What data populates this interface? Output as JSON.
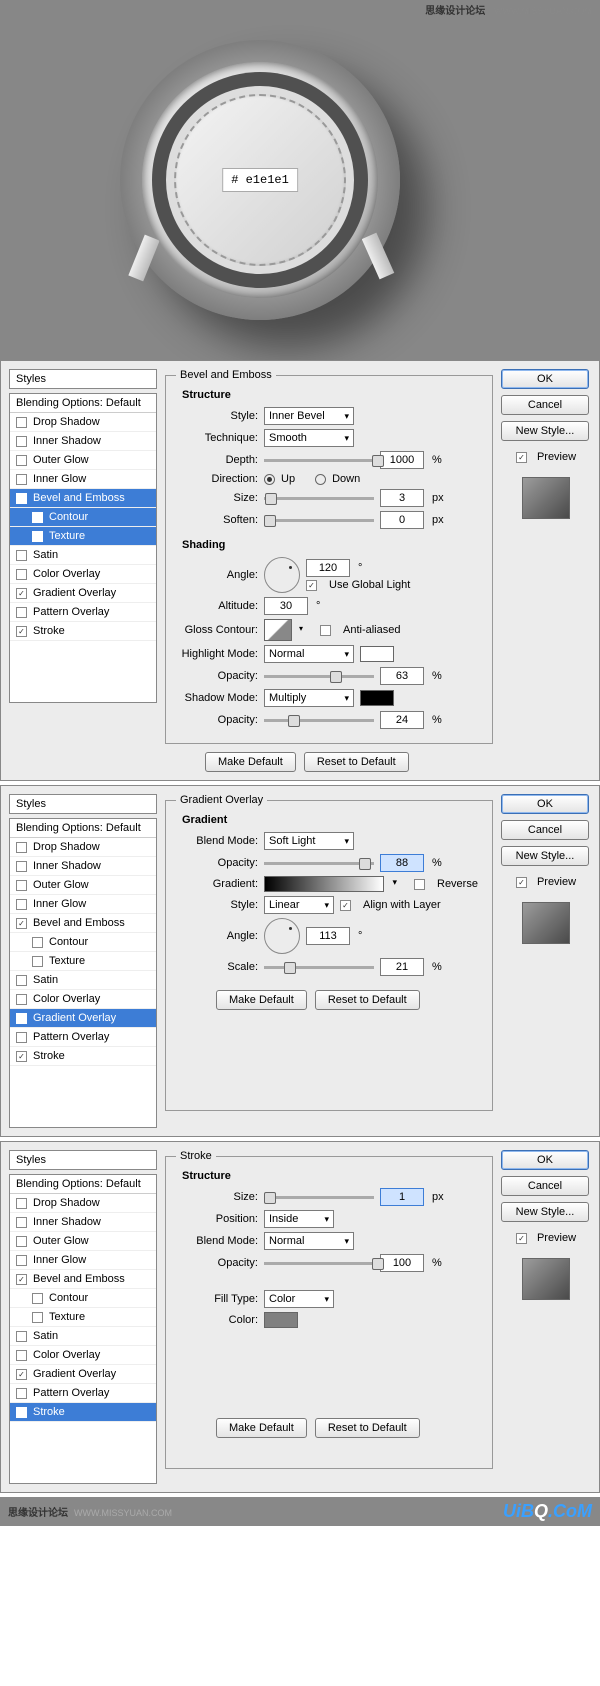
{
  "watermark": {
    "title": "思缘设计论坛",
    "url": "WWW.MISSYUAN.COM"
  },
  "knob": {
    "color_label": "# e1e1e1"
  },
  "common": {
    "styles_head": "Styles",
    "blending_header": "Blending Options: Default",
    "ok": "OK",
    "cancel": "Cancel",
    "new_style": "New Style...",
    "preview": "Preview",
    "make_default": "Make Default",
    "reset_default": "Reset to Default",
    "effects": {
      "drop_shadow": "Drop Shadow",
      "inner_shadow": "Inner Shadow",
      "outer_glow": "Outer Glow",
      "inner_glow": "Inner Glow",
      "bevel_emboss": "Bevel and Emboss",
      "contour": "Contour",
      "texture": "Texture",
      "satin": "Satin",
      "color_overlay": "Color Overlay",
      "gradient_overlay": "Gradient Overlay",
      "pattern_overlay": "Pattern Overlay",
      "stroke": "Stroke"
    }
  },
  "bevel": {
    "title": "Bevel and Emboss",
    "structure": "Structure",
    "style_label": "Style:",
    "style_value": "Inner Bevel",
    "technique_label": "Technique:",
    "technique_value": "Smooth",
    "depth_label": "Depth:",
    "depth_value": "1000",
    "depth_unit": "%",
    "direction_label": "Direction:",
    "up": "Up",
    "down": "Down",
    "size_label": "Size:",
    "size_value": "3",
    "size_unit": "px",
    "soften_label": "Soften:",
    "soften_value": "0",
    "soften_unit": "px",
    "shading": "Shading",
    "angle_label": "Angle:",
    "angle_value": "120",
    "angle_unit": "°",
    "global_light": "Use Global Light",
    "altitude_label": "Altitude:",
    "altitude_value": "30",
    "altitude_unit": "°",
    "gloss_label": "Gloss Contour:",
    "anti_aliased": "Anti-aliased",
    "highlight_mode_label": "Highlight Mode:",
    "highlight_mode_value": "Normal",
    "opacity_label": "Opacity:",
    "highlight_opacity": "63",
    "opacity_unit": "%",
    "shadow_mode_label": "Shadow Mode:",
    "shadow_mode_value": "Multiply",
    "shadow_opacity": "24"
  },
  "gradient": {
    "title": "Gradient Overlay",
    "section": "Gradient",
    "blend_mode_label": "Blend Mode:",
    "blend_mode_value": "Soft Light",
    "opacity_label": "Opacity:",
    "opacity_value": "88",
    "opacity_unit": "%",
    "gradient_label": "Gradient:",
    "reverse": "Reverse",
    "style_label": "Style:",
    "style_value": "Linear",
    "align": "Align with Layer",
    "angle_label": "Angle:",
    "angle_value": "113",
    "angle_unit": "°",
    "scale_label": "Scale:",
    "scale_value": "21",
    "scale_unit": "%"
  },
  "stroke": {
    "title": "Stroke",
    "structure": "Structure",
    "size_label": "Size:",
    "size_value": "1",
    "size_unit": "px",
    "position_label": "Position:",
    "position_value": "Inside",
    "blend_mode_label": "Blend Mode:",
    "blend_mode_value": "Normal",
    "opacity_label": "Opacity:",
    "opacity_value": "100",
    "opacity_unit": "%",
    "fill_type_label": "Fill Type:",
    "fill_type_value": "Color",
    "color_label": "Color:"
  },
  "footer": {
    "brand1": "UiB",
    "brand2": "Q",
    "brand3": ".CoM"
  }
}
